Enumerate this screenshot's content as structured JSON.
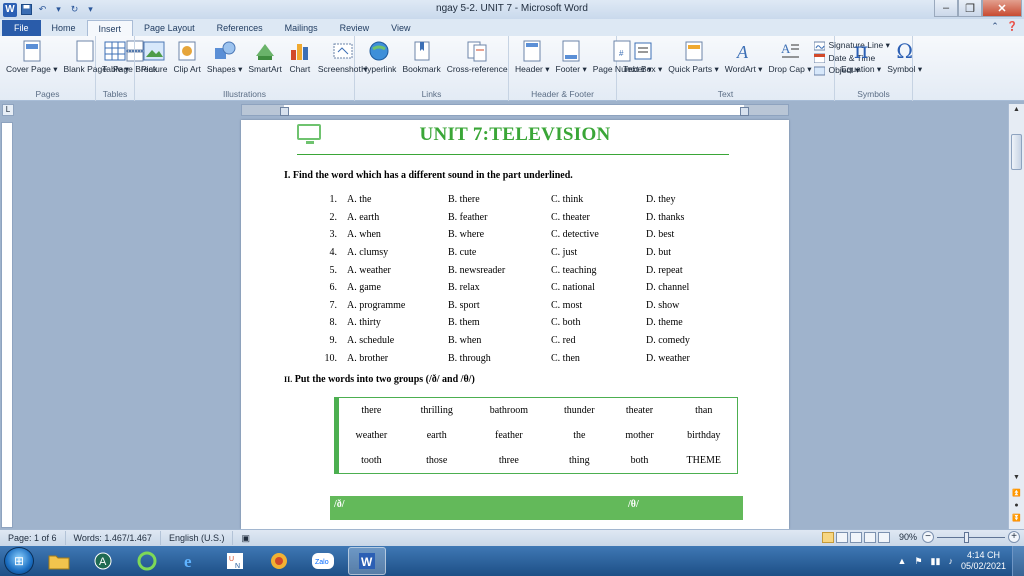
{
  "titlebar": {
    "title": "ngay 5-2. UNIT 7  -  Microsoft Word",
    "app_icon": "W",
    "controls": {
      "minimize": "–",
      "maximize": "❐",
      "close": "✕"
    }
  },
  "tabs": [
    "Home",
    "Insert",
    "Page Layout",
    "References",
    "Mailings",
    "Review",
    "View"
  ],
  "file_tab": "File",
  "active_tab": "Insert",
  "ribbon": {
    "pages": {
      "label": "Pages",
      "buttons": [
        "Cover Page ▾",
        "Blank Page",
        "Page Break"
      ]
    },
    "tables": {
      "label": "Tables",
      "buttons": [
        "Table ▾"
      ]
    },
    "illustrations": {
      "label": "Illustrations",
      "buttons": [
        "Picture",
        "Clip Art",
        "Shapes ▾",
        "SmartArt",
        "Chart",
        "Screenshot ▾"
      ]
    },
    "links": {
      "label": "Links",
      "buttons": [
        "Hyperlink",
        "Bookmark",
        "Cross-reference"
      ]
    },
    "header_footer": {
      "label": "Header & Footer",
      "buttons": [
        "Header ▾",
        "Footer ▾",
        "Page Number ▾"
      ]
    },
    "text": {
      "label": "Text",
      "buttons": [
        "Text Box ▾",
        "Quick Parts ▾",
        "WordArt ▾",
        "Drop Cap ▾"
      ],
      "small": [
        "Signature Line ▾",
        "Date & Time",
        "Object ▾"
      ]
    },
    "symbols": {
      "label": "Symbols",
      "buttons": [
        "Equation ▾",
        "Symbol ▾"
      ]
    }
  },
  "document": {
    "title": "UNIT 7:TELEVISION",
    "section1": "I. Find the word which has a different sound in the part underlined.",
    "questions": [
      {
        "num": "1.",
        "a": "A.  the",
        "b": "B. there",
        "c": "C. think",
        "d": "D. they"
      },
      {
        "num": "2.",
        "a": "A.  earth",
        "b": "B. feather",
        "c": "C. theater",
        "d": "D. thanks"
      },
      {
        "num": "3.",
        "a": "A.  when",
        "b": "B. where",
        "c": "C. detective",
        "d": "D. best"
      },
      {
        "num": "4.",
        "a": "A.  clumsy",
        "b": "B. cute",
        "c": "C. just",
        "d": "D. but"
      },
      {
        "num": "5.",
        "a": "A.  weather",
        "b": "B. newsreader",
        "c": "C. teaching",
        "d": "D. repeat"
      },
      {
        "num": "6.",
        "a": "A.  game",
        "b": "B. relax",
        "c": "C. national",
        "d": "D. channel"
      },
      {
        "num": "7.",
        "a": "A.  programme",
        "b": "B. sport",
        "c": "C. most",
        "d": "D. show"
      },
      {
        "num": "8.",
        "a": "A.  thirty",
        "b": "B. them",
        "c": "C. both",
        "d": "D. theme"
      },
      {
        "num": "9.",
        "a": "A.  schedule",
        "b": "B. when",
        "c": "C. red",
        "d": "D. comedy"
      },
      {
        "num": "10.",
        "a": "A.  brother",
        "b": "B. through",
        "c": "C. then",
        "d": "D. weather"
      }
    ],
    "section2_num": "II.",
    "section2": "Put the words into two groups (/ð/ and /θ/)",
    "words": [
      [
        "there",
        "thrilling",
        "bathroom",
        "thunder",
        "theater",
        "than"
      ],
      [
        "weather",
        "earth",
        "feather",
        "the",
        "mother",
        "birthday"
      ],
      [
        "tooth",
        "those",
        "three",
        "thing",
        "both",
        "THEME"
      ]
    ],
    "group1": "/ð/",
    "group2": "/θ/"
  },
  "statusbar": {
    "page": "Page: 1 of 6",
    "words": "Words: 1.467/1.467",
    "language": "English (U.S.)",
    "zoom": "90%"
  },
  "taskbar": {
    "apps": [
      "folder",
      "app-a",
      "app-c",
      "ie",
      "unikey",
      "app-sun",
      "Zalo",
      "W"
    ],
    "time": "4:14 CH",
    "date": "05/02/2021"
  },
  "colors": {
    "accent_green": "#3aa637",
    "file_tab": "#2a5caa",
    "taskbar": "#1d4f86"
  }
}
